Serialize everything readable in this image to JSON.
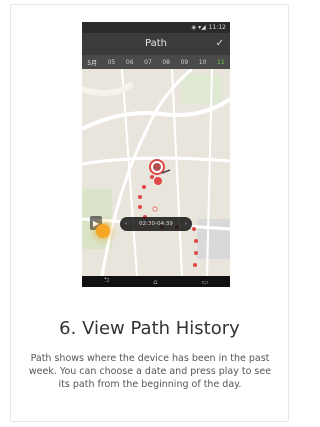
{
  "status_bar": {
    "time": "11:12"
  },
  "app_bar": {
    "title": "Path",
    "confirm_icon": "check-icon"
  },
  "date_selector": {
    "month": "5月",
    "days": [
      "05",
      "06",
      "07",
      "08",
      "09",
      "10",
      "11"
    ],
    "selected_day": "11"
  },
  "playback": {
    "time_range": "02:30-04:39",
    "prev_icon": "chevron-left-icon",
    "next_icon": "chevron-right-icon",
    "play_icon": "play-icon"
  },
  "nav_bar": {
    "items": [
      "back-icon",
      "home-icon",
      "recents-icon"
    ]
  },
  "colors": {
    "accent": "#f5a623",
    "path": "#e04848",
    "selected": "#6ecf4c"
  },
  "heading": "6. View Path History",
  "description": "Path shows where the device has been in the past week. You can choose a date and press play to see its path from the beginning of the day."
}
